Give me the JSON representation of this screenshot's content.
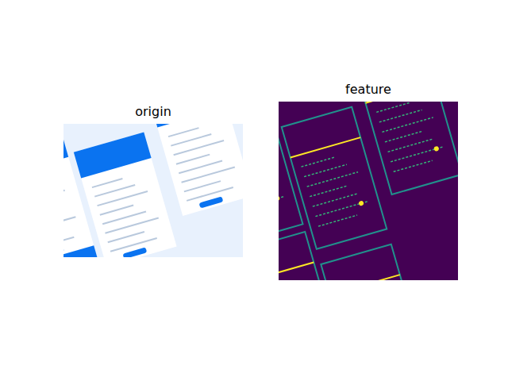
{
  "figure": {
    "panels": [
      {
        "title": "origin",
        "kind": "photo"
      },
      {
        "title": "feature",
        "kind": "heatmap"
      }
    ]
  }
}
